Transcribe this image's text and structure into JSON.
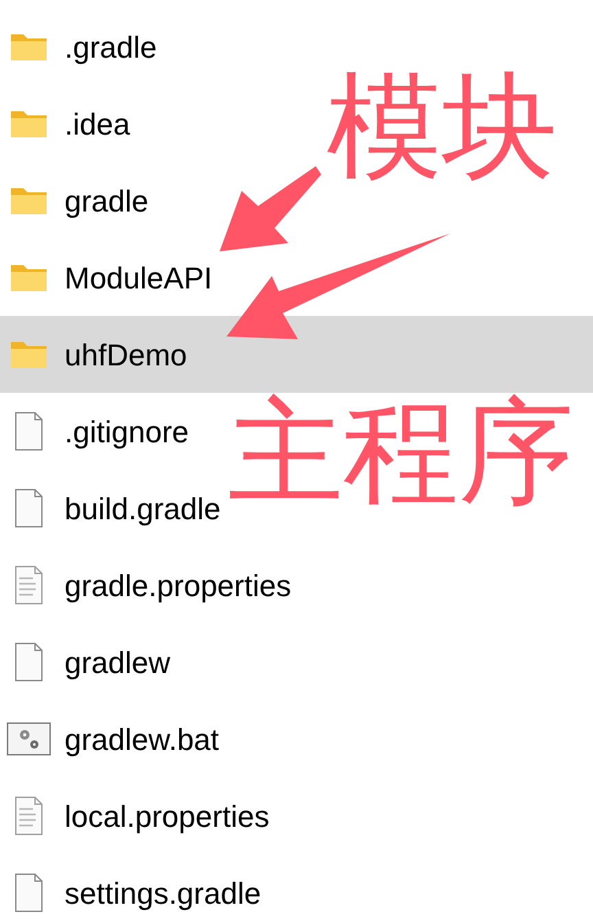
{
  "files": [
    {
      "name": ".gradle",
      "kind": "folder",
      "selected": false
    },
    {
      "name": ".idea",
      "kind": "folder",
      "selected": false
    },
    {
      "name": "gradle",
      "kind": "folder",
      "selected": false
    },
    {
      "name": "ModuleAPI",
      "kind": "folder",
      "selected": false
    },
    {
      "name": "uhfDemo",
      "kind": "folder",
      "selected": true
    },
    {
      "name": ".gitignore",
      "kind": "file",
      "selected": false
    },
    {
      "name": "build.gradle",
      "kind": "file",
      "selected": false
    },
    {
      "name": "gradle.properties",
      "kind": "text",
      "selected": false
    },
    {
      "name": "gradlew",
      "kind": "file",
      "selected": false
    },
    {
      "name": "gradlew.bat",
      "kind": "batch",
      "selected": false
    },
    {
      "name": "local.properties",
      "kind": "text",
      "selected": false
    },
    {
      "name": "settings.gradle",
      "kind": "file",
      "selected": false
    }
  ],
  "annotations": [
    {
      "text": "模块"
    },
    {
      "text": "主程序"
    }
  ]
}
